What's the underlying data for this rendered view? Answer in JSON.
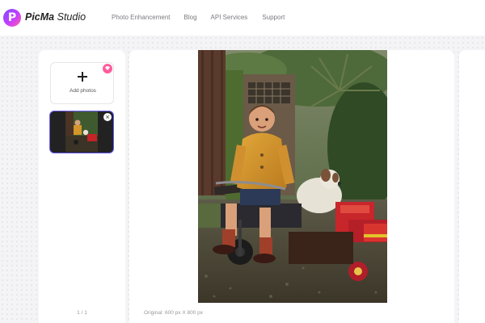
{
  "header": {
    "logo_letter": "P",
    "brand_bold": "PicMa",
    "brand_light": " Studio",
    "nav": [
      "Photo Enhancement",
      "Blog",
      "API Services",
      "Support"
    ]
  },
  "sidebar": {
    "add_label": "Add photos",
    "thumb_close": "×",
    "pager": "1 / 1"
  },
  "preview": {
    "caption": "Original: 600 px X 800 px"
  },
  "colors": {
    "accent": "#6b5cff",
    "badge": "#ff5c9d",
    "logo_gradient": [
      "#7a4cff",
      "#c63dff",
      "#ff5fa8"
    ]
  }
}
